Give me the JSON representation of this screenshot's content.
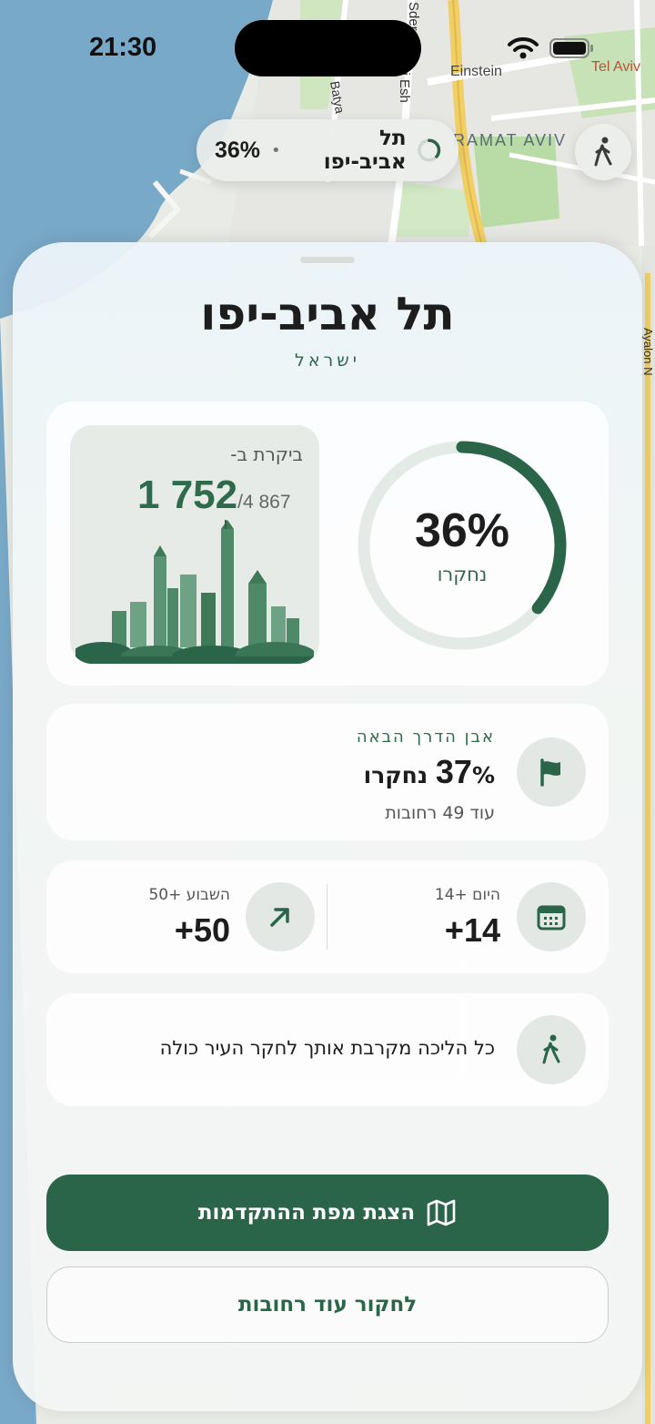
{
  "status_bar": {
    "time": "21:30"
  },
  "map": {
    "labels": [
      "Einstein",
      "Tel Aviv",
      "RAMAT AVIV",
      "Sder",
      "vi Esh",
      "Batya",
      "Ayalon N"
    ]
  },
  "top_pill": {
    "percent": "36%",
    "separator": "•",
    "city": "תל אביב-יפו",
    "progress_fraction": 0.36
  },
  "sheet": {
    "city": "תל אביב-יפו",
    "country": "ישראל",
    "progress": {
      "percent_label": "36%",
      "caption": "נחקרו",
      "fraction": 0.36
    },
    "visited": {
      "label": "ביקרת ב-",
      "count": "1 752",
      "total": "/4 867"
    },
    "milestone": {
      "caption": "אבן הדרך הבאה",
      "percent": "37",
      "percent_suffix": "% נחקרו",
      "remaining": "עוד 49 רחובות"
    },
    "gains": {
      "today_caption": "היום +14",
      "today_value": "+14",
      "week_caption": "השבוע +50",
      "week_value": "+50"
    },
    "tip": {
      "text": "כל הליכה מקרבת אותך לחקר העיר כולה"
    },
    "buttons": {
      "primary": "הצגת מפת ההתקדמות",
      "secondary": "לחקור עוד רחובות"
    }
  },
  "colors": {
    "accent": "#2b6549",
    "accent_text": "#2f6a4c",
    "ring_track": "#e4ebe7"
  },
  "icons": [
    "walking-icon",
    "flag-icon",
    "calendar-icon",
    "trend-up-icon",
    "map-icon",
    "skyline-illustration"
  ]
}
